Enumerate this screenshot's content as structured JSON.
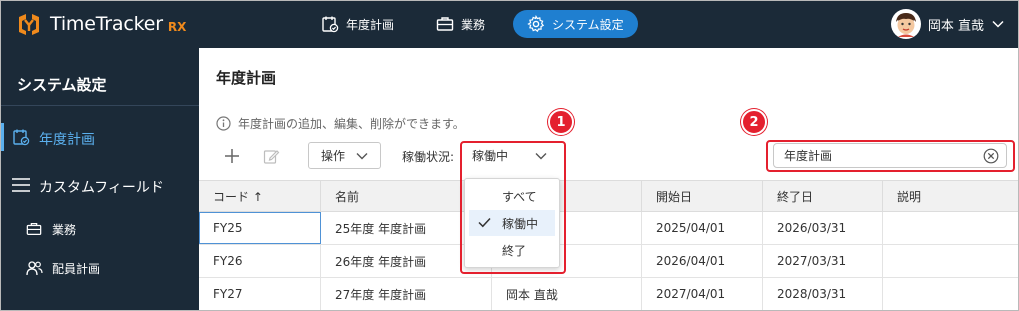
{
  "app": {
    "name": "TimeTracker",
    "suffix": "RX"
  },
  "nav": [
    {
      "label": "年度計画",
      "icon": "calendar-check-icon"
    },
    {
      "label": "業務",
      "icon": "briefcase-icon"
    },
    {
      "label": "システム設定",
      "icon": "gear-icon",
      "active": true
    }
  ],
  "user": {
    "name": "岡本 直哉"
  },
  "sidebar": {
    "title": "システム設定",
    "items": [
      {
        "label": "年度計画",
        "icon": "calendar-check-icon",
        "active": true
      },
      {
        "label": "カスタムフィールド",
        "icon": "hamburger-icon"
      },
      {
        "label": "業務",
        "icon": "briefcase-icon"
      },
      {
        "label": "配員計画",
        "icon": "people-icon"
      }
    ]
  },
  "main": {
    "title": "年度計画",
    "info": "年度計画の追加、編集、削除ができます。",
    "toolbar": {
      "operation_label": "操作",
      "status_label": "稼働状況:",
      "status_value": "稼働中",
      "search_value": "年度計画"
    }
  },
  "table": {
    "columns": [
      "コード ↑",
      "名前",
      "",
      "開始日",
      "終了日",
      "説明"
    ],
    "rows": [
      [
        "FY25",
        "25年度 年度計画",
        "",
        "2025/04/01",
        "2026/03/31",
        ""
      ],
      [
        "FY26",
        "26年度 年度計画",
        "",
        "2026/04/01",
        "2027/03/31",
        ""
      ],
      [
        "FY27",
        "27年度 年度計画",
        "岡本 直哉",
        "2027/04/01",
        "2028/03/31",
        ""
      ]
    ]
  },
  "dropdown": {
    "options": [
      "すべて",
      "稼働中",
      "終了"
    ],
    "selected": "稼働中"
  },
  "annotations": {
    "badge1": "1",
    "badge2": "2"
  },
  "colors": {
    "topbar": "#1b2a38",
    "accent": "#1f7fd0",
    "sidebar_active": "#5bb0ee",
    "annotation": "#e4202e",
    "logo_orange": "#f08a1c"
  }
}
